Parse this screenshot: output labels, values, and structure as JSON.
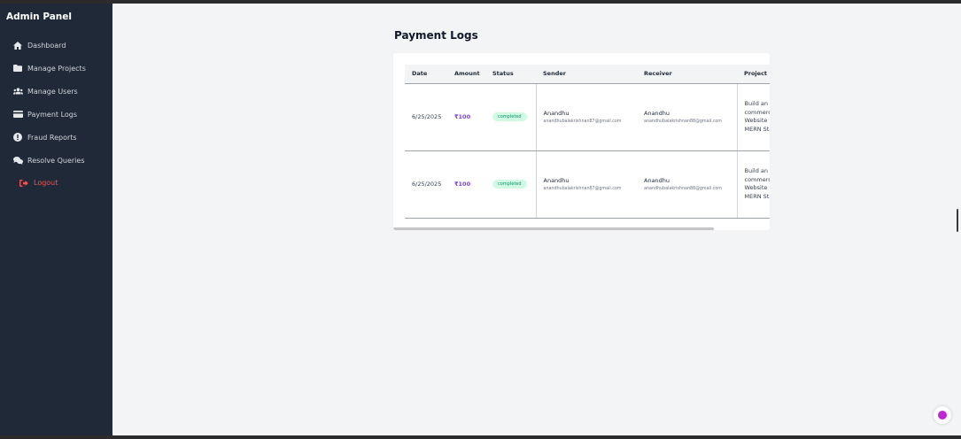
{
  "sidebar": {
    "title": "Admin Panel",
    "items": [
      {
        "label": "Dashboard",
        "icon": "home-icon"
      },
      {
        "label": "Manage Projects",
        "icon": "folder-icon"
      },
      {
        "label": "Manage Users",
        "icon": "users-icon"
      },
      {
        "label": "Payment Logs",
        "icon": "credit-card-icon"
      },
      {
        "label": "Fraud Reports",
        "icon": "exclamation-circle-icon"
      },
      {
        "label": "Resolve Queries",
        "icon": "chat-icon"
      }
    ],
    "logout": "Logout"
  },
  "main": {
    "title": "Payment Logs",
    "table": {
      "headers": [
        "Date",
        "Amount",
        "Status",
        "Sender",
        "Receiver",
        "Project"
      ],
      "rows": [
        {
          "date": "6/25/2025",
          "amount": "₹100",
          "status": "completed",
          "sender_name": "Anandhu",
          "sender_email": "anandhubalakrishnan87@gmail.com",
          "receiver_name": "Anandhu",
          "receiver_email": "anandhubalakrishnan88@gmail.com",
          "project": "Build an E commerce Website with MERN Stack"
        },
        {
          "date": "6/25/2025",
          "amount": "₹100",
          "status": "completed",
          "sender_name": "Anandhu",
          "sender_email": "anandhubalakrishnan87@gmail.com",
          "receiver_name": "Anandhu",
          "receiver_email": "anandhubalakrishnan88@gmail.com",
          "project": "Build an E commerce Website with MERN Stack"
        }
      ]
    }
  },
  "colors": {
    "sidebar_bg": "#1f2937",
    "amount": "#7c3aed",
    "status_bg": "#d1fae5",
    "status_text": "#059669",
    "logout": "#f05252"
  }
}
